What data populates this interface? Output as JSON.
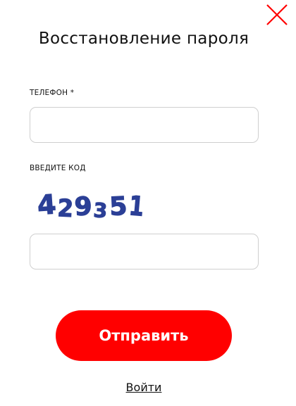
{
  "dialog": {
    "title": "Восстановление пароля"
  },
  "form": {
    "phone": {
      "label": "ТЕЛЕФОН *",
      "value": "",
      "placeholder": ""
    },
    "code": {
      "label": "ВВЕДИТЕ КОД",
      "captcha_text": "429351",
      "value": "",
      "placeholder": ""
    }
  },
  "actions": {
    "submit_label": "Отправить",
    "login_link": "Войти",
    "close_icon": "close-icon"
  },
  "colors": {
    "accent": "#ff0000",
    "captcha": "#2b3f96",
    "text": "#111111",
    "input_border": "#cfcfcf"
  }
}
